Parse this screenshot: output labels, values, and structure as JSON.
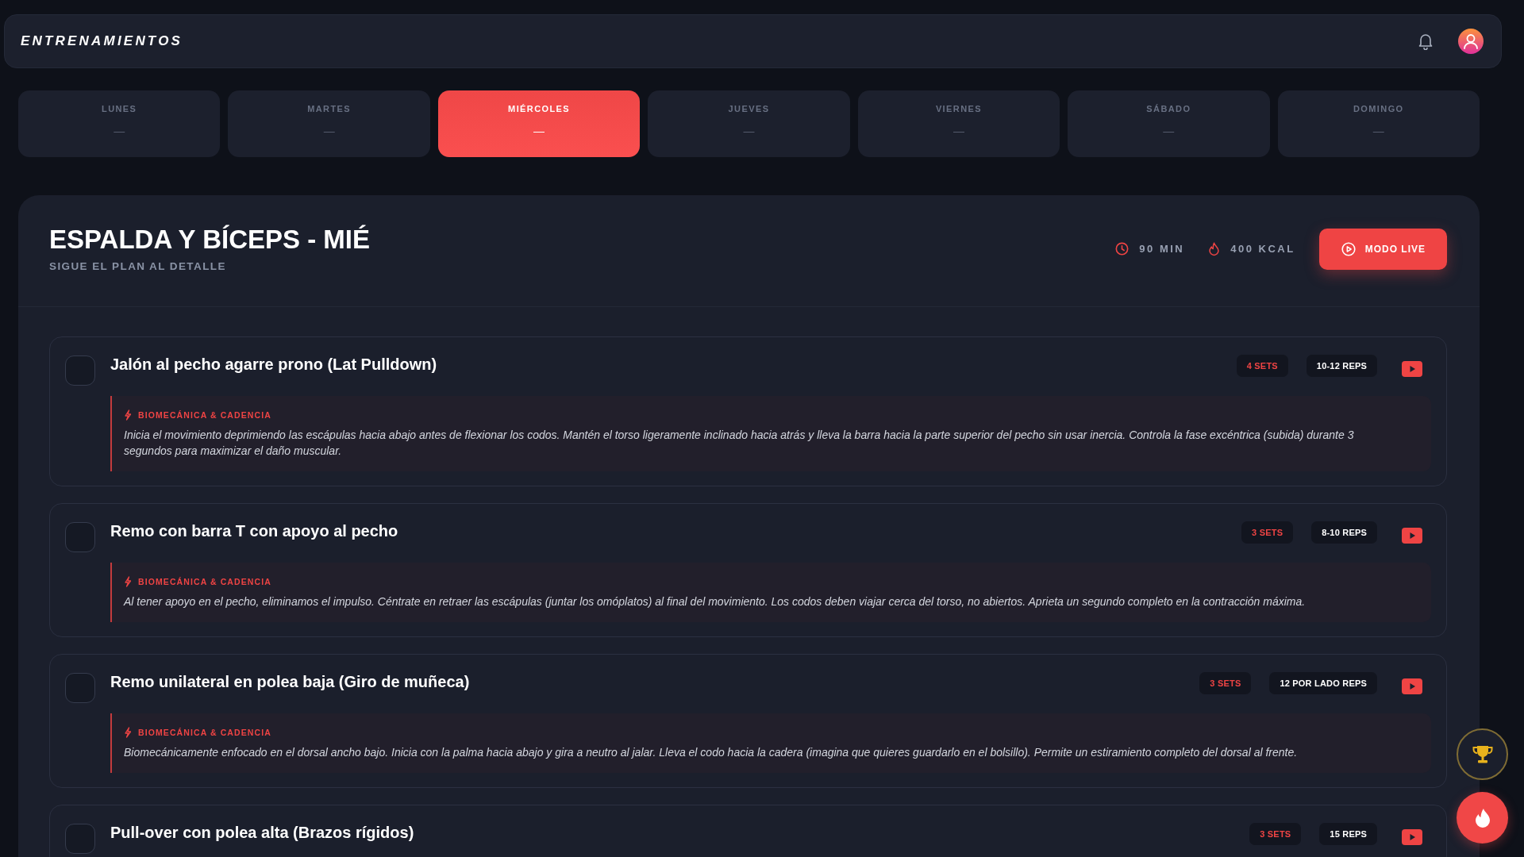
{
  "header": {
    "title": "ENTRENAMIENTOS"
  },
  "days": [
    {
      "label": "LUNES",
      "value": "—",
      "selected": false
    },
    {
      "label": "MARTES",
      "value": "—",
      "selected": false
    },
    {
      "label": "MIÉRCOLES",
      "value": "—",
      "selected": true
    },
    {
      "label": "JUEVES",
      "value": "—",
      "selected": false
    },
    {
      "label": "VIERNES",
      "value": "—",
      "selected": false
    },
    {
      "label": "SÁBADO",
      "value": "—",
      "selected": false
    },
    {
      "label": "DOMINGO",
      "value": "—",
      "selected": false
    }
  ],
  "workout": {
    "title": "ESPALDA Y BÍCEPS - MIÉ",
    "subtitle": "SIGUE EL PLAN AL DETALLE",
    "stats": [
      {
        "kind": "duration",
        "text": "90 MIN"
      },
      {
        "kind": "calories",
        "text": "400 KCAL"
      }
    ],
    "live_button": "MODO LIVE"
  },
  "exercises": [
    {
      "name": "Jalón al pecho agarre prono (Lat Pulldown)",
      "done": false,
      "sets": "4 SETS",
      "reps": "10-12 REPS",
      "note_label": "BIOMECÁNICA & CADENCIA",
      "note": "Inicia el movimiento deprimiendo las escápulas hacia abajo antes de flexionar los codos. Mantén el torso ligeramente inclinado hacia atrás y lleva la barra hacia la parte superior del pecho sin usar inercia. Controla la fase excéntrica (subida) durante 3 segundos para maximizar el daño muscular."
    },
    {
      "name": "Remo con barra T con apoyo al pecho",
      "done": false,
      "sets": "3 SETS",
      "reps": "8-10 REPS",
      "note_label": "BIOMECÁNICA & CADENCIA",
      "note": "Al tener apoyo en el pecho, eliminamos el impulso. Céntrate en retraer las escápulas (juntar los omóplatos) al final del movimiento. Los codos deben viajar cerca del torso, no abiertos. Aprieta un segundo completo en la contracción máxima."
    },
    {
      "name": "Remo unilateral en polea baja (Giro de muñeca)",
      "done": false,
      "sets": "3 SETS",
      "reps": "12 POR LADO REPS",
      "note_label": "BIOMECÁNICA & CADENCIA",
      "note": "Biomecánicamente enfocado en el dorsal ancho bajo. Inicia con la palma hacia abajo y gira a neutro al jalar. Lleva el codo hacia la cadera (imagina que quieres guardarlo en el bolsillo). Permite un estiramiento completo del dorsal al frente."
    },
    {
      "name": "Pull-over con polea alta (Brazos rígidos)",
      "done": false,
      "sets": "3 SETS",
      "reps": "15 REPS"
    }
  ]
}
